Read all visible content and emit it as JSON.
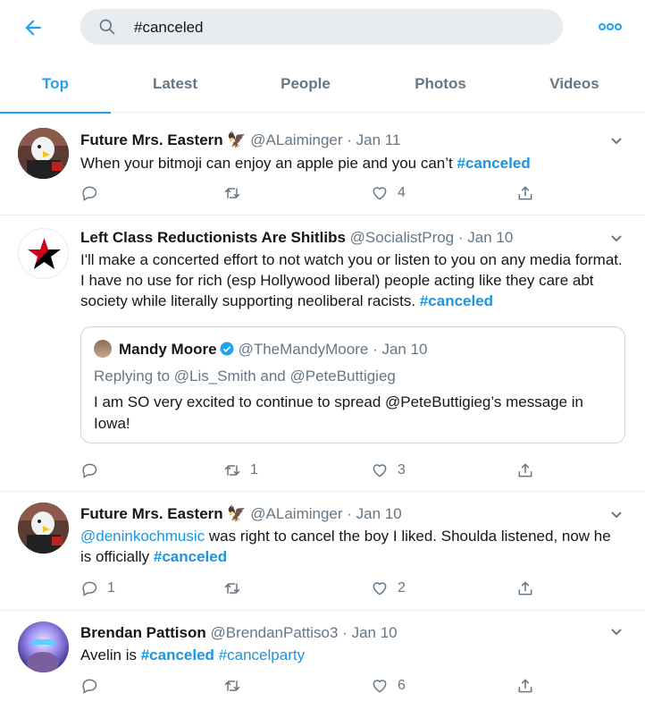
{
  "search": {
    "query": "#canceled"
  },
  "tabs": [
    {
      "label": "Top",
      "active": true
    },
    {
      "label": "Latest",
      "active": false
    },
    {
      "label": "People",
      "active": false
    },
    {
      "label": "Photos",
      "active": false
    },
    {
      "label": "Videos",
      "active": false
    }
  ],
  "tweets": [
    {
      "name": "Future Mrs. Eastern",
      "emoji": "🦅",
      "handle": "@ALaiminger",
      "date": "· Jan 11",
      "text_before": "When your bitmoji can enjoy an apple pie and you can’t ",
      "tags": [
        "#canceled"
      ],
      "replies": "",
      "retweets": "",
      "likes": "4"
    },
    {
      "name": "Left Class Reductionists Are Shitlibs",
      "handle": "@SocialistProg",
      "date": "· Jan 10",
      "text_before": "I'll make a concerted effort to not watch you or listen to you on any media format. I have no use for rich (esp Hollywood liberal) people acting like they care abt society while literally supporting neoliberal racists. ",
      "tags": [
        "#canceled"
      ],
      "quote": {
        "name": "Mandy Moore",
        "handle": "@TheMandyMoore",
        "date": "· Jan 10",
        "replying_to": "Replying to @Lis_Smith and @PeteButtigieg",
        "text": "I am SO very excited to continue to spread @PeteButtigieg’s message in Iowa!"
      },
      "replies": "",
      "retweets": "1",
      "likes": "3"
    },
    {
      "name": "Future Mrs. Eastern",
      "emoji": "🦅",
      "handle": "@ALaiminger",
      "date": "· Jan 10",
      "mention": "@deninkochmusic",
      "text_before": " was right to cancel the boy I liked. Shoulda listened, now he is officially ",
      "tags": [
        "#canceled"
      ],
      "replies": "1",
      "retweets": "",
      "likes": "2"
    },
    {
      "name": "Brendan Pattison",
      "handle": "@BrendanPattiso3",
      "date": "· Jan 10",
      "text_before": "Avelin is ",
      "tags": [
        "#canceled",
        "#cancelparty"
      ],
      "replies": "",
      "retweets": "",
      "likes": "6"
    }
  ],
  "icons": {
    "back": "back-arrow-icon",
    "search": "search-icon",
    "more": "more-dots-icon",
    "caret": "chevron-down-icon",
    "reply": "reply-icon",
    "retweet": "retweet-icon",
    "like": "heart-icon",
    "share": "share-icon",
    "verified": "verified-badge-icon"
  },
  "colors": {
    "accent": "#1da1f2",
    "link": "#1b95e0",
    "muted": "#657786",
    "search_bg": "#e6ecf0"
  }
}
